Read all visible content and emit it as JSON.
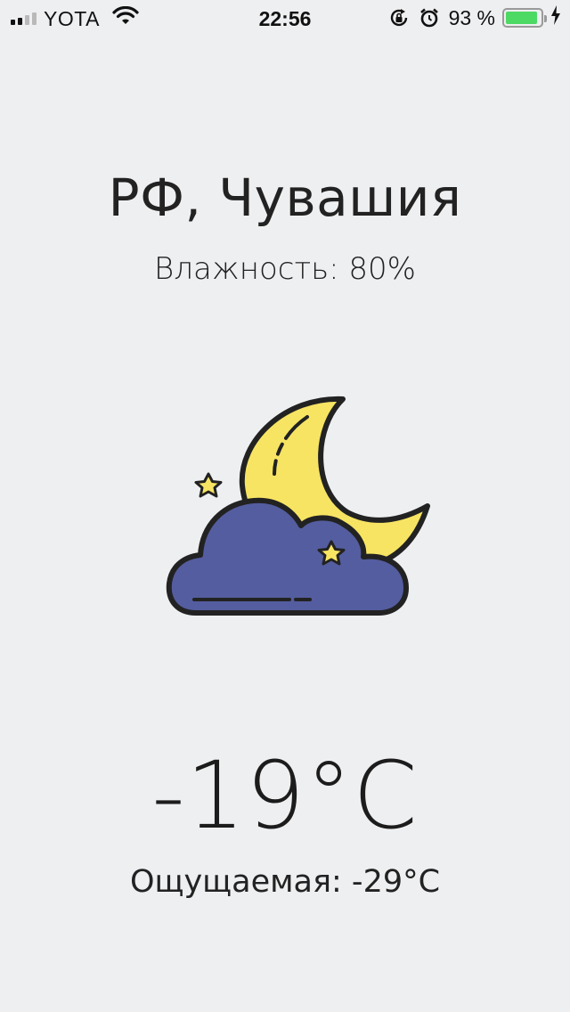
{
  "status_bar": {
    "carrier": "YOTA",
    "time": "22:56",
    "battery_percent_label": "93 %",
    "battery_level": 0.93,
    "battery_color": "#4cd964",
    "icons": [
      "signal-icon",
      "wifi-icon",
      "rotation-lock-icon",
      "alarm-icon",
      "battery-icon",
      "charging-bolt-icon"
    ]
  },
  "weather": {
    "location": "РФ, Чувашия",
    "humidity": "Влажность: 80%",
    "condition_icon": "night-cloudy-icon",
    "temperature": "-19°C",
    "feels_like": "Ощущаемая: -29°C"
  },
  "colors": {
    "background": "#eeeff1",
    "moon": "#f7e463",
    "cloud": "#545d9f",
    "outline": "#222222"
  }
}
